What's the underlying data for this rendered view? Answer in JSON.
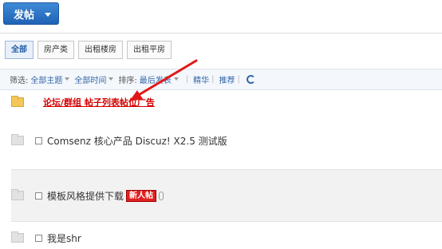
{
  "post_button": {
    "label": "发帖"
  },
  "type_tabs": [
    "全部",
    "房产类",
    "出租楼房",
    "出租平房"
  ],
  "filter": {
    "label": "筛选:",
    "theme": "全部主题",
    "time": "全部时间",
    "sort_label": "排序:",
    "sort_value": "最后发表",
    "digest": "精华",
    "recommend": "推荐"
  },
  "ad_row": {
    "text": "论坛/群组 帖子列表帖位广告"
  },
  "threads": [
    {
      "title": "Comsenz 核心产品 Discuz! X2.5 测试版"
    },
    {
      "title": "模板风格提供下载",
      "badge": "新人帖"
    },
    {
      "title": "我是shr"
    }
  ],
  "colors": {
    "accent": "#1f62b5",
    "ad_red": "#d40000",
    "arrow_red": "#e01818"
  }
}
